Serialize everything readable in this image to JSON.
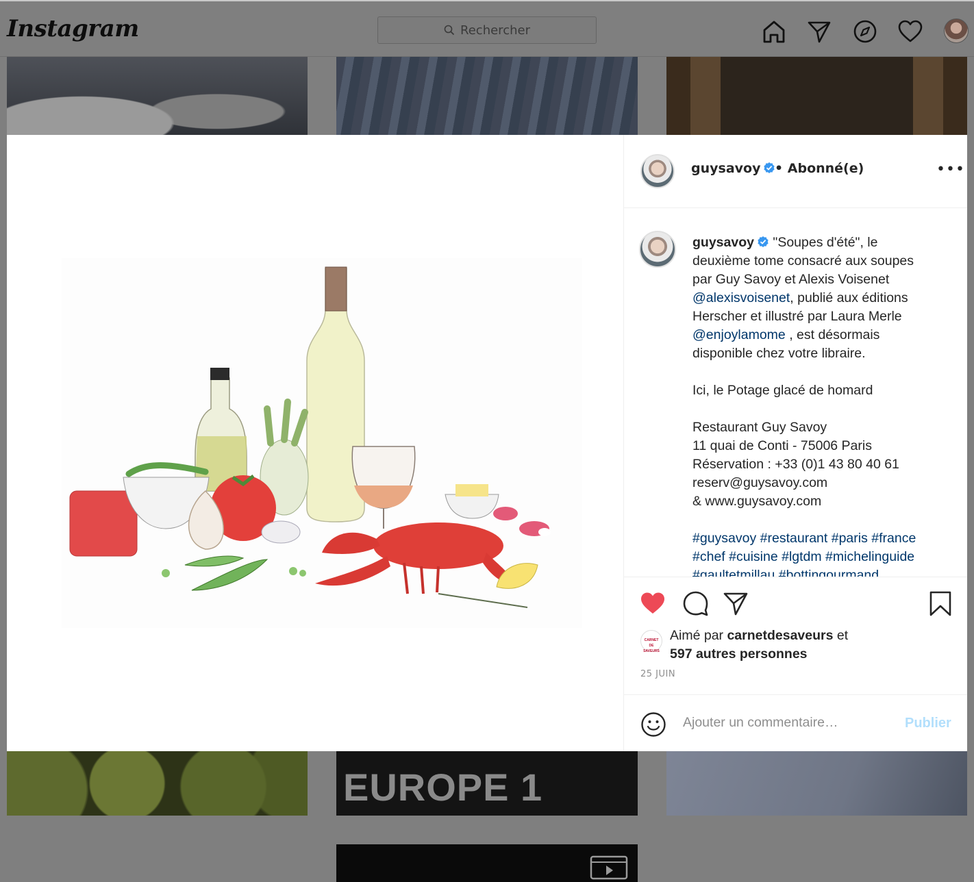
{
  "app": {
    "name": "Instagram"
  },
  "search": {
    "placeholder": "Rechercher"
  },
  "nav": {
    "icons": [
      "home-icon",
      "direct-icon",
      "explore-icon",
      "activity-icon",
      "profile-avatar"
    ]
  },
  "grid": {
    "tile5_text": "EUROPE 1"
  },
  "post": {
    "author": "guysavoy",
    "follow_status": "• Abonné(e)",
    "more": "•••",
    "caption_lines": [
      {
        "parts": [
          {
            "t": "\"Soupes d'été\", le"
          }
        ]
      },
      {
        "parts": [
          {
            "t": "deuxième tome consacré aux soupes"
          }
        ]
      },
      {
        "parts": [
          {
            "t": "par Guy Savoy et Alexis Voisenet"
          }
        ]
      },
      {
        "parts": [
          {
            "t": "@alexisvoisenet",
            "k": "mention"
          },
          {
            "t": ", publié aux éditions"
          }
        ]
      },
      {
        "parts": [
          {
            "t": "Herscher et illustré par Laura Merle"
          }
        ]
      },
      {
        "parts": [
          {
            "t": "@enjoylamome",
            "k": "mention"
          },
          {
            "t": " , est désormais"
          }
        ]
      },
      {
        "parts": [
          {
            "t": "disponible chez votre libraire."
          }
        ]
      },
      {
        "parts": [
          {
            "t": " "
          }
        ]
      },
      {
        "parts": [
          {
            "t": "Ici, le Potage glacé de homard"
          }
        ]
      },
      {
        "parts": [
          {
            "t": " "
          }
        ]
      },
      {
        "parts": [
          {
            "t": "Restaurant Guy Savoy"
          }
        ]
      },
      {
        "parts": [
          {
            "t": "11 quai de Conti - 75006 Paris"
          }
        ]
      },
      {
        "parts": [
          {
            "t": "Réservation : +33 (0)1 43 80 40 61"
          }
        ]
      },
      {
        "parts": [
          {
            "t": "reserv@guysavoy.com"
          }
        ]
      },
      {
        "parts": [
          {
            "t": "& www.guysavoy.com"
          }
        ]
      },
      {
        "parts": [
          {
            "t": " "
          }
        ]
      },
      {
        "parts": [
          {
            "t": "#guysavoy",
            "k": "tag"
          },
          {
            "t": " "
          },
          {
            "t": "#restaurant",
            "k": "tag"
          },
          {
            "t": " "
          },
          {
            "t": "#paris",
            "k": "tag"
          },
          {
            "t": " "
          },
          {
            "t": "#france",
            "k": "tag"
          }
        ]
      },
      {
        "parts": [
          {
            "t": "#chef",
            "k": "tag"
          },
          {
            "t": " "
          },
          {
            "t": "#cuisine",
            "k": "tag"
          },
          {
            "t": " "
          },
          {
            "t": "#lgtdm",
            "k": "tag"
          },
          {
            "t": " "
          },
          {
            "t": "#michelinguide",
            "k": "tag"
          }
        ]
      },
      {
        "parts": [
          {
            "t": "#gaultetmillau",
            "k": "tag"
          },
          {
            "t": " "
          },
          {
            "t": "#bottingourmand",
            "k": "tag"
          }
        ]
      }
    ],
    "likes": {
      "prefix": "Aimé par ",
      "liker": "carnetdesaveurs",
      "joiner": " et",
      "others": "597 autres personnes",
      "liker_avatar_text": "CARNET DE SAVEURS"
    },
    "date": "25 JUIN",
    "comment": {
      "placeholder": "Ajouter un commentaire…",
      "publish": "Publier"
    },
    "liked": true
  },
  "colors": {
    "like_red": "#ed4956",
    "link_blue": "#00376b",
    "verified_blue": "#3897f0",
    "publish_disabled": "#b2dffc",
    "overlay_gray": "#7f7f7f"
  }
}
